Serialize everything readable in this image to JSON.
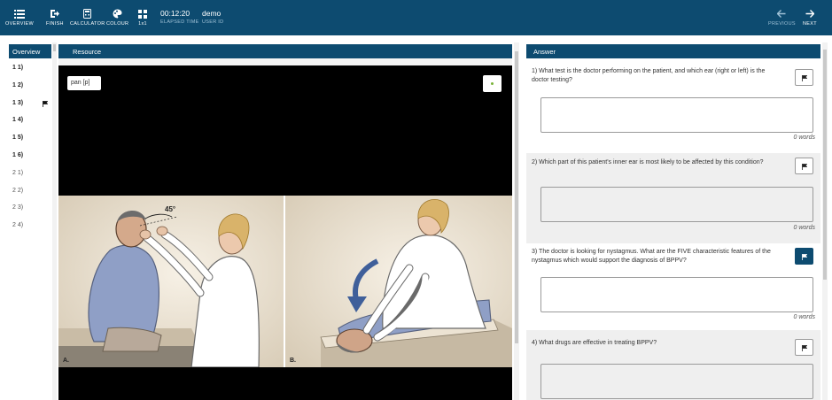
{
  "toolbar": {
    "overview_label": "OVERVIEW",
    "finish_label": "FINISH",
    "calculator_label": "CALCULATOR",
    "colour_label": "COLOUR",
    "layout_label": "1x1",
    "elapsed_time": "00:12:20",
    "elapsed_time_label": "ELAPSED TIME",
    "user_id": "demo",
    "user_id_label": "USER ID",
    "previous_label": "PREVIOUS",
    "next_label": "NEXT"
  },
  "overview": {
    "title": "Overview",
    "items": [
      {
        "label": "1 1)",
        "flagged": false,
        "muted": false
      },
      {
        "label": "1 2)",
        "flagged": false,
        "muted": false
      },
      {
        "label": "1 3)",
        "flagged": true,
        "muted": false
      },
      {
        "label": "1 4)",
        "flagged": false,
        "muted": false
      },
      {
        "label": "1 5)",
        "flagged": false,
        "muted": false
      },
      {
        "label": "1 6)",
        "flagged": false,
        "muted": false
      },
      {
        "label": "2 1)",
        "flagged": false,
        "muted": true
      },
      {
        "label": "2 2)",
        "flagged": false,
        "muted": true
      },
      {
        "label": "2 3)",
        "flagged": false,
        "muted": true
      },
      {
        "label": "2 4)",
        "flagged": false,
        "muted": true
      }
    ]
  },
  "resource": {
    "title": "Resource",
    "pan_label": "pan [p]",
    "figure_a_label": "A.",
    "figure_a_angle": "45°",
    "figure_b_label": "B."
  },
  "answer": {
    "title": "Answer",
    "questions": [
      {
        "text": "1) What test is the doctor performing on the patient, and which ear (right or left) is the doctor testing?",
        "words": "0 words",
        "flag_active": false
      },
      {
        "text": "2) Which part of this patient's inner ear is most likely to be affected by this condition?",
        "words": "0 words",
        "flag_active": false
      },
      {
        "text": "3) The doctor is looking for nystagmus. What are the FIVE characteristic features of the nystagmus which would support the diagnosis of BPPV?",
        "words": "0 words",
        "flag_active": true
      },
      {
        "text": "4) What drugs are effective in treating BPPV?",
        "words": "",
        "flag_active": false
      }
    ]
  },
  "colors": {
    "header": "#0d4b70",
    "page": "#ffffff",
    "shaded_question": "#efefef",
    "active_flag": "#0d4b70"
  }
}
